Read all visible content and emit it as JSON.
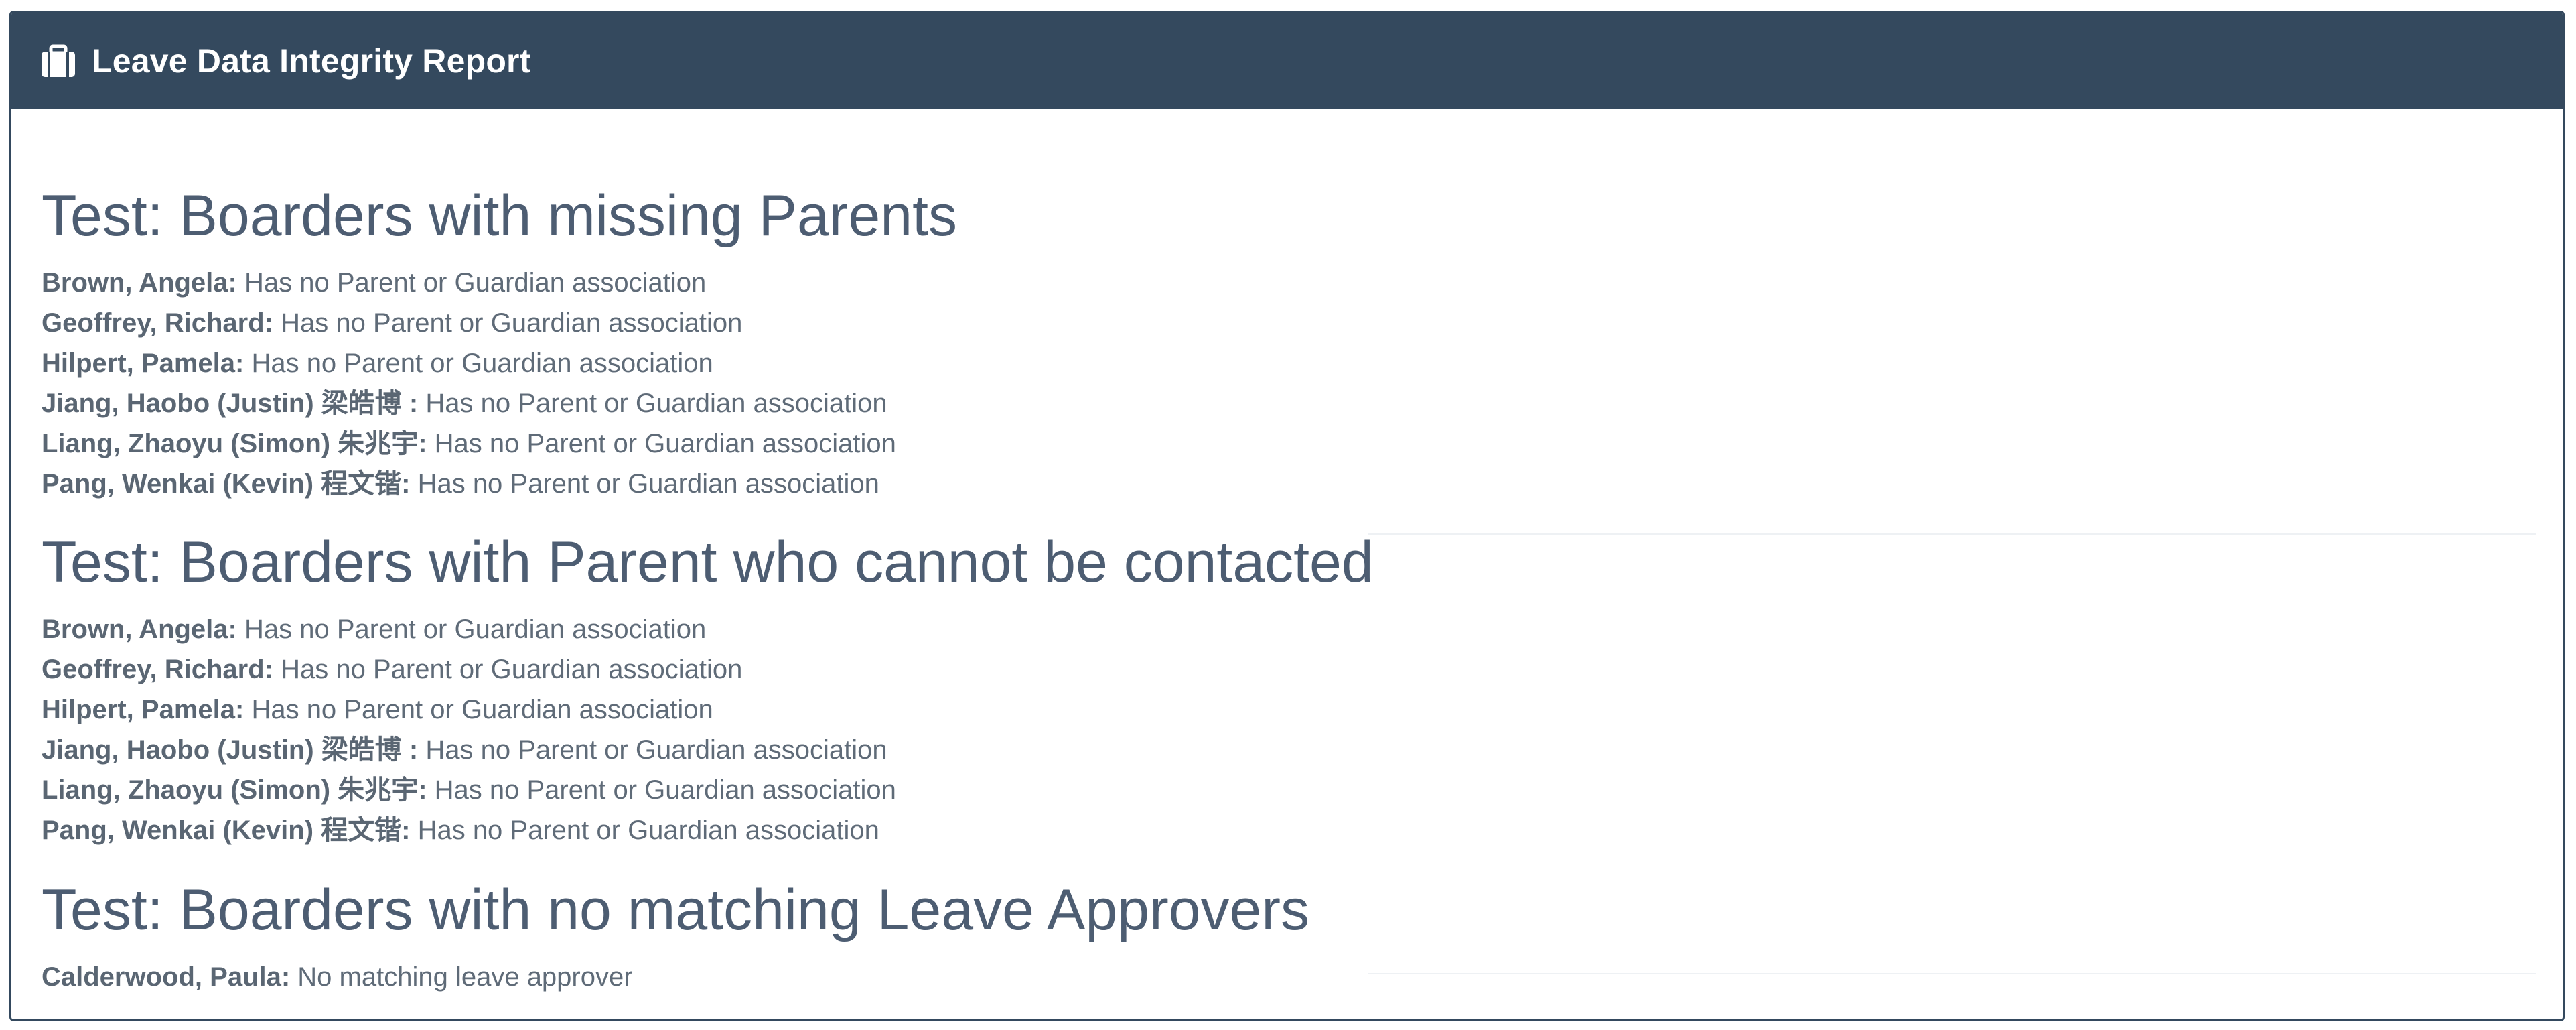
{
  "panel": {
    "title": "Leave Data Integrity Report",
    "icon": "briefcase-icon",
    "header_color": "#34495e"
  },
  "sections": [
    {
      "title": "Test: Boarders with missing Parents",
      "entries": [
        {
          "name": "Brown, Angela:",
          "message": " Has no Parent or Guardian association"
        },
        {
          "name": "Geoffrey, Richard:",
          "message": " Has no Parent or Guardian association"
        },
        {
          "name": "Hilpert, Pamela:",
          "message": " Has no Parent or Guardian association"
        },
        {
          "name": "Jiang,  Haobo (Justin) 梁皓博 :",
          "message": " Has no Parent or Guardian association"
        },
        {
          "name": "Liang,  Zhaoyu (Simon) 朱兆宇:",
          "message": " Has no Parent or Guardian association"
        },
        {
          "name": "Pang,  Wenkai (Kevin) 程文锴:",
          "message": " Has no Parent or Guardian association"
        }
      ]
    },
    {
      "title": "Test: Boarders with Parent who cannot be contacted",
      "entries": [
        {
          "name": "Brown, Angela:",
          "message": " Has no Parent or Guardian association"
        },
        {
          "name": "Geoffrey, Richard:",
          "message": "  Has no Parent or Guardian association"
        },
        {
          "name": "Hilpert, Pamela:",
          "message": " Has no Parent or Guardian association"
        },
        {
          "name": "Jiang,  Haobo (Justin) 梁皓博 :",
          "message": " Has no Parent or Guardian association"
        },
        {
          "name": "Liang,  Zhaoyu (Simon) 朱兆宇:",
          "message": " Has no Parent or Guardian association"
        },
        {
          "name": "Pang,  Wenkai (Kevin) 程文锴:",
          "message": "  Has no Parent or Guardian association"
        }
      ]
    },
    {
      "title": "Test: Boarders with no matching Leave Approvers",
      "entries": [
        {
          "name": "Calderwood, Paula:",
          "message": " No matching leave approver"
        }
      ]
    }
  ]
}
